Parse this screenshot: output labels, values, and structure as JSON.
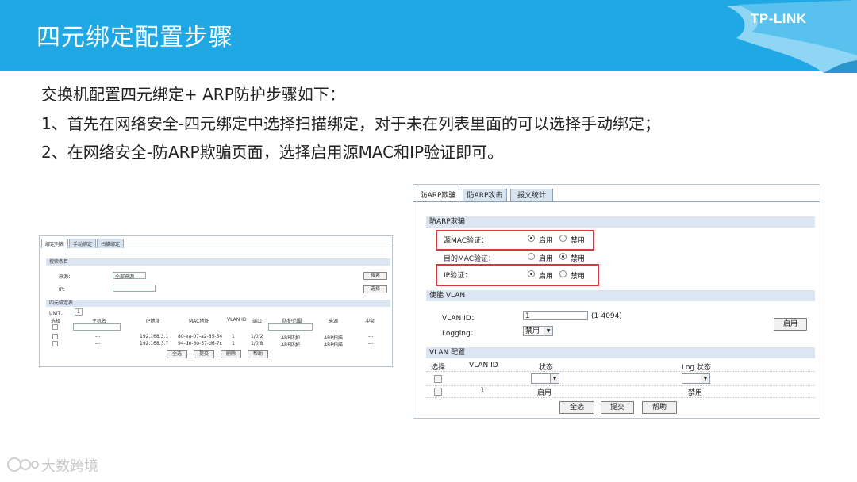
{
  "slide": {
    "title": "四元绑定配置步骤",
    "logo": "TP-LINK",
    "lines": [
      "交换机配置四元绑定+ ARP防护步骤如下：",
      "1、首先在网络安全-四元绑定中选择扫描绑定，对于未在列表里面的可以选择手动绑定；",
      "2、在网络安全-防ARP欺骗页面，选择启用源MAC和IP验证即可。"
    ],
    "watermark": "大数跨境"
  },
  "binding_screenshot": {
    "tabs": [
      "绑定列表",
      "手动绑定",
      "扫描绑定"
    ],
    "search_section": "搜索条目",
    "source_label": "来源：",
    "source_value": "全部来源",
    "ip_label": "IP：",
    "search_button": "搜索",
    "select_button": "选择",
    "table_section": "四元绑定表",
    "unit_label": "UNIT：",
    "unit_value": "1",
    "columns": [
      "选择",
      "主机名",
      "IP地址",
      "MAC地址",
      "VLAN ID",
      "端口",
      "防护范围",
      "来源",
      "冲突"
    ],
    "rows": [
      [
        "---",
        "192.168.3.1",
        "80-ea-07-a2-85-54",
        "1",
        "1/0/2",
        "ARP防护",
        "ARP扫描",
        "---"
      ],
      [
        "---",
        "192.168.3.7",
        "94-de-80-57-d6-7c",
        "1",
        "1/0/8",
        "ARP防护",
        "ARP扫描",
        "---"
      ]
    ],
    "buttons": [
      "全选",
      "提交",
      "删除",
      "帮助"
    ]
  },
  "arp_screenshot": {
    "tabs": [
      "防ARP欺骗",
      "防ARP攻击",
      "报文统计"
    ],
    "section_arp": "防ARP欺骗",
    "options": [
      {
        "label": "源MAC验证：",
        "enable": "启用",
        "disable": "禁用"
      },
      {
        "label": "目的MAC验证：",
        "enable": "启用",
        "disable": "禁用"
      },
      {
        "label": "IP验证：",
        "enable": "启用",
        "disable": "禁用"
      }
    ],
    "section_vlan": "使能 VLAN",
    "vlan_id_label": "VLAN ID：",
    "vlan_id_value": "1",
    "vlan_range": "(1-4094)",
    "logging_label": "Logging：",
    "logging_value": "禁用",
    "enable_button": "启用",
    "section_config": "VLAN 配置",
    "config_columns": [
      "选择",
      "VLAN ID",
      "状态",
      "Log 状态"
    ],
    "config_row": {
      "vlan": "1",
      "status": "启用",
      "log": "禁用"
    },
    "buttons": [
      "全选",
      "提交",
      "帮助"
    ],
    "highlight_color": "#d8383a"
  },
  "colors": {
    "header_blue": "#1fa8e4",
    "section_bg": "#dce6f2"
  }
}
